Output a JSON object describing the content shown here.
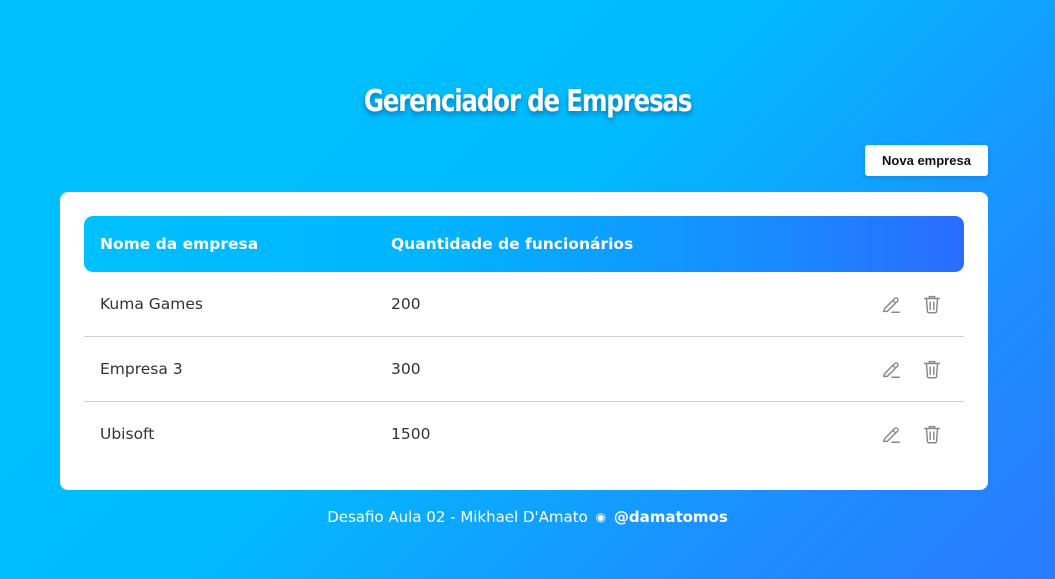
{
  "page": {
    "title": "Gerenciador de Empresas"
  },
  "toolbar": {
    "new_company_label": "Nova empresa"
  },
  "table": {
    "headers": {
      "name": "Nome da empresa",
      "employees": "Quantidade de funcionários"
    },
    "rows": [
      {
        "name": "Kuma Games",
        "employees": "200",
        "actions": [
          "pencil-icon",
          "trash-icon"
        ]
      },
      {
        "name": "Empresa 3",
        "employees": "300",
        "actions": [
          "pencil-icon",
          "trash-icon"
        ]
      },
      {
        "name": "Ubisoft",
        "employees": "1500",
        "actions": [
          "pencil-icon",
          "trash-icon"
        ]
      }
    ]
  },
  "footer": {
    "text": "Desafio Aula 02 - Mikhael D'Amato",
    "separator": "◉",
    "handle": "@damatomos"
  },
  "colors": {
    "background_start": "#00c0ff",
    "background_end": "#2a7bff",
    "header_start": "#00c0ff",
    "header_end": "#2b6cff",
    "card": "#ffffff",
    "icon": "#8a8a8a"
  }
}
